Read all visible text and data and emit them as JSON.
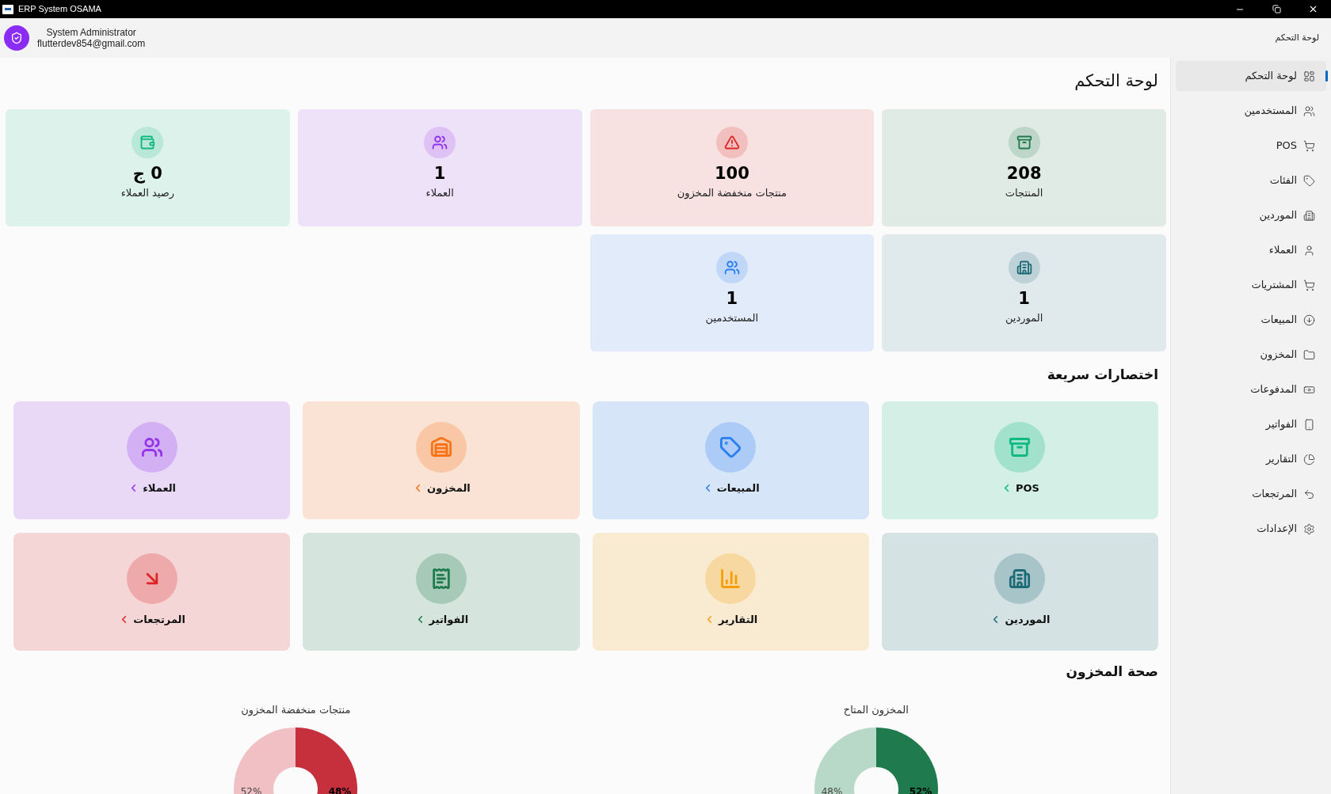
{
  "window": {
    "title": "ERP System OSAMA"
  },
  "header": {
    "user_name": "System Administrator",
    "email": "flutterdev854@gmail.com",
    "page_title": "لوحة التحكم"
  },
  "sidebar": {
    "items": [
      {
        "label": "لوحة التحكم",
        "selected": true
      },
      {
        "label": "المستخدمين",
        "selected": false
      },
      {
        "label": "POS",
        "selected": false
      },
      {
        "label": "الفئات",
        "selected": false
      },
      {
        "label": "الموردين",
        "selected": false
      },
      {
        "label": "العملاء",
        "selected": false
      },
      {
        "label": "المشتريات",
        "selected": false
      },
      {
        "label": "المبيعات",
        "selected": false
      },
      {
        "label": "المخزون",
        "selected": false
      },
      {
        "label": "المدفوعات",
        "selected": false
      },
      {
        "label": "الفواتير",
        "selected": false
      },
      {
        "label": "التقارير",
        "selected": false
      },
      {
        "label": "المرتجعات",
        "selected": false
      },
      {
        "label": "الإعدادات",
        "selected": false
      }
    ]
  },
  "dashboard": {
    "title": "لوحة التحكم",
    "stats": [
      {
        "value": "208",
        "label": "المنتجات",
        "color": "#1f7a4d"
      },
      {
        "value": "100",
        "label": "منتجات منخفضة المخزون",
        "color": "#dc2626"
      },
      {
        "value": "1",
        "label": "العملاء",
        "color": "#9333ea"
      },
      {
        "value": "0 ج",
        "label": "رصيد العملاء",
        "color": "#10b981"
      },
      {
        "value": "1",
        "label": "الموردين",
        "color": "#1e6b78"
      },
      {
        "value": "1",
        "label": "المستخدمين",
        "color": "#2a7ff0"
      }
    ],
    "shortcuts_title": "اختصارات سريعة",
    "shortcuts": [
      {
        "label": "POS",
        "color": "#10b981"
      },
      {
        "label": "المبيعات",
        "color": "#2a7ff0"
      },
      {
        "label": "المخزون",
        "color": "#f97316"
      },
      {
        "label": "العملاء",
        "color": "#9333ea"
      },
      {
        "label": "الموردين",
        "color": "#1e6b78"
      },
      {
        "label": "التقارير",
        "color": "#f59e0b"
      },
      {
        "label": "الفواتير",
        "color": "#1f7a4d"
      },
      {
        "label": "المرتجعات",
        "color": "#dc2626"
      }
    ],
    "inventory_health": {
      "title": "صحة المخزون",
      "charts": [
        {
          "chart_data": {
            "type": "donut",
            "title": "المخزون المتاح",
            "values": [
              52,
              48
            ],
            "value_labels": [
              "52%",
              "48%"
            ]
          }
        },
        {
          "chart_data": {
            "type": "donut",
            "title": "منتجات منخفضة المخزون",
            "values": [
              48,
              52
            ],
            "value_labels": [
              "48%",
              "52%"
            ]
          }
        }
      ]
    }
  }
}
